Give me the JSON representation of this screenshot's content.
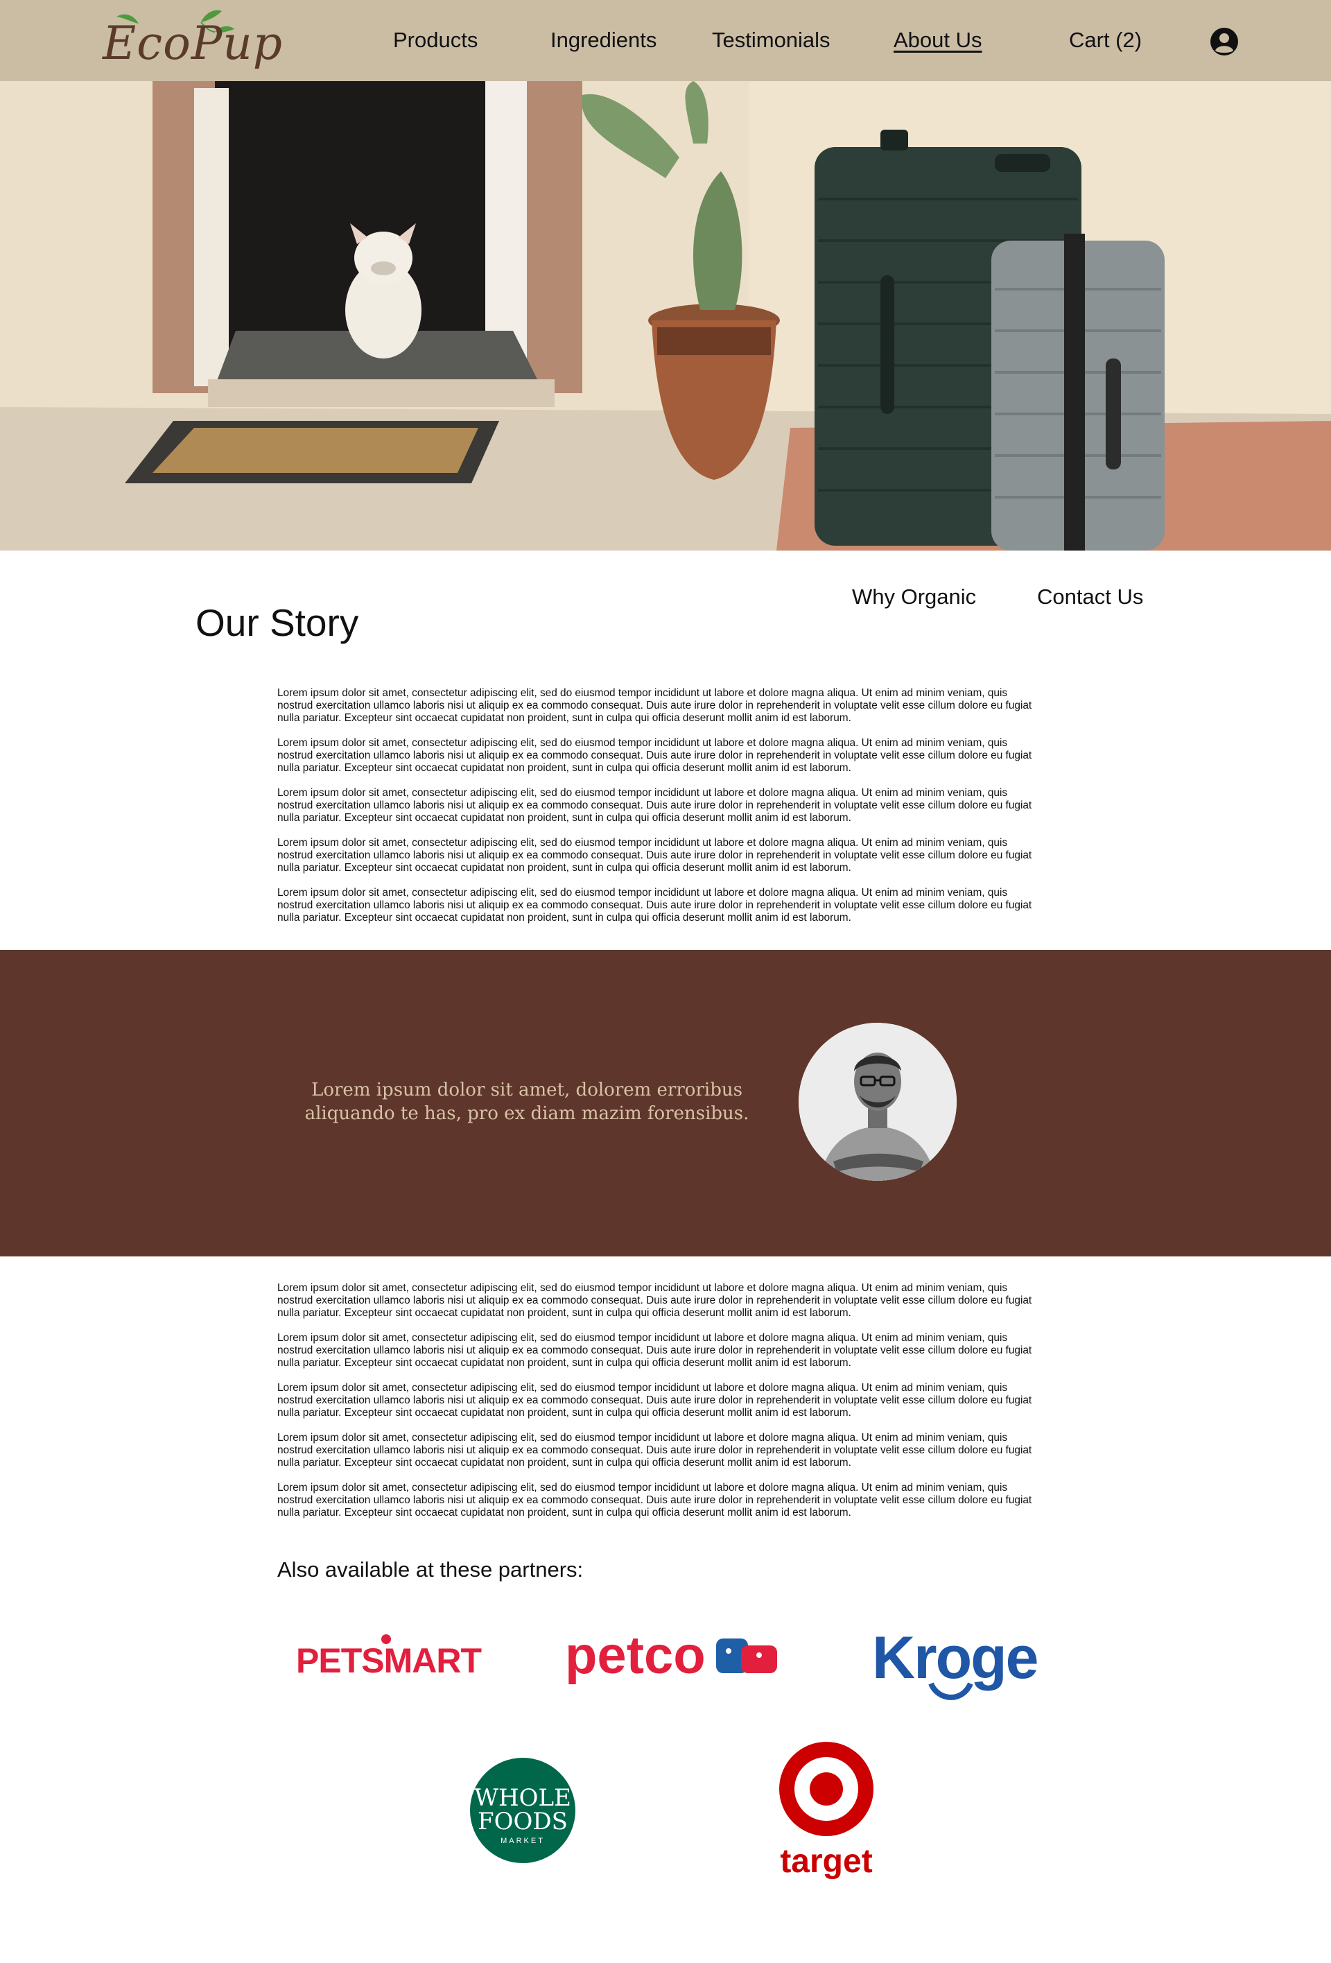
{
  "brand": {
    "name": "EcoPup",
    "color": "#5a3a2a",
    "leaf_color": "#4f9a3f"
  },
  "nav": {
    "items": [
      {
        "label": "Products",
        "active": false
      },
      {
        "label": "Ingredients",
        "active": false
      },
      {
        "label": "Testimonials",
        "active": false
      },
      {
        "label": "About Us",
        "active": true
      },
      {
        "label": "Cart (2)",
        "active": false
      }
    ],
    "account_icon": "user-circle-icon"
  },
  "colors": {
    "header_bg": "#cabda4",
    "quote_band_bg": "#5e362b",
    "quote_text": "#d8c2a8"
  },
  "story": {
    "title": "Our Story",
    "sub_nav": [
      "Why Organic",
      "Contact Us"
    ],
    "paragraphs_top": [
      "Lorem ipsum dolor sit amet, consectetur adipiscing elit, sed do eiusmod tempor incididunt ut labore et dolore magna aliqua. Ut enim ad minim veniam, quis nostrud exercitation ullamco laboris nisi ut aliquip ex ea commodo consequat. Duis aute irure dolor in reprehenderit in voluptate velit esse cillum dolore eu fugiat nulla pariatur. Excepteur sint occaecat cupidatat non proident, sunt in culpa qui officia deserunt mollit anim id est laborum.",
      "Lorem ipsum dolor sit amet, consectetur adipiscing elit, sed do eiusmod tempor incididunt ut labore et dolore magna aliqua. Ut enim ad minim veniam, quis nostrud exercitation ullamco laboris nisi ut aliquip ex ea commodo consequat. Duis aute irure dolor in reprehenderit in voluptate velit esse cillum dolore eu fugiat nulla pariatur. Excepteur sint occaecat cupidatat non proident, sunt in culpa qui officia deserunt mollit anim id est laborum.",
      "Lorem ipsum dolor sit amet, consectetur adipiscing elit, sed do eiusmod tempor incididunt ut labore et dolore magna aliqua. Ut enim ad minim veniam, quis nostrud exercitation ullamco laboris nisi ut aliquip ex ea commodo consequat. Duis aute irure dolor in reprehenderit in voluptate velit esse cillum dolore eu fugiat nulla pariatur. Excepteur sint occaecat cupidatat non proident, sunt in culpa qui officia deserunt mollit anim id est laborum.",
      "Lorem ipsum dolor sit amet, consectetur adipiscing elit, sed do eiusmod tempor incididunt ut labore et dolore magna aliqua. Ut enim ad minim veniam, quis nostrud exercitation ullamco laboris nisi ut aliquip ex ea commodo consequat. Duis aute irure dolor in reprehenderit in voluptate velit esse cillum dolore eu fugiat nulla pariatur. Excepteur sint occaecat cupidatat non proident, sunt in culpa qui officia deserunt mollit anim id est laborum.",
      "Lorem ipsum dolor sit amet, consectetur adipiscing elit, sed do eiusmod tempor incididunt ut labore et dolore magna aliqua. Ut enim ad minim veniam, quis nostrud exercitation ullamco laboris nisi ut aliquip ex ea commodo consequat. Duis aute irure dolor in reprehenderit in voluptate velit esse cillum dolore eu fugiat nulla pariatur. Excepteur sint occaecat cupidatat non proident, sunt in culpa qui officia deserunt mollit anim id est laborum."
    ],
    "paragraphs_bottom": [
      "Lorem ipsum dolor sit amet, consectetur adipiscing elit, sed do eiusmod tempor incididunt ut labore et dolore magna aliqua. Ut enim ad minim veniam, quis nostrud exercitation ullamco laboris nisi ut aliquip ex ea commodo consequat. Duis aute irure dolor in reprehenderit in voluptate velit esse cillum dolore eu fugiat nulla pariatur. Excepteur sint occaecat cupidatat non proident, sunt in culpa qui officia deserunt mollit anim id est laborum.",
      "Lorem ipsum dolor sit amet, consectetur adipiscing elit, sed do eiusmod tempor incididunt ut labore et dolore magna aliqua. Ut enim ad minim veniam, quis nostrud exercitation ullamco laboris nisi ut aliquip ex ea commodo consequat. Duis aute irure dolor in reprehenderit in voluptate velit esse cillum dolore eu fugiat nulla pariatur. Excepteur sint occaecat cupidatat non proident, sunt in culpa qui officia deserunt mollit anim id est laborum.",
      "Lorem ipsum dolor sit amet, consectetur adipiscing elit, sed do eiusmod tempor incididunt ut labore et dolore magna aliqua. Ut enim ad minim veniam, quis nostrud exercitation ullamco laboris nisi ut aliquip ex ea commodo consequat. Duis aute irure dolor in reprehenderit in voluptate velit esse cillum dolore eu fugiat nulla pariatur. Excepteur sint occaecat cupidatat non proident, sunt in culpa qui officia deserunt mollit anim id est laborum.",
      "Lorem ipsum dolor sit amet, consectetur adipiscing elit, sed do eiusmod tempor incididunt ut labore et dolore magna aliqua. Ut enim ad minim veniam, quis nostrud exercitation ullamco laboris nisi ut aliquip ex ea commodo consequat. Duis aute irure dolor in reprehenderit in voluptate velit esse cillum dolore eu fugiat nulla pariatur. Excepteur sint occaecat cupidatat non proident, sunt in culpa qui officia deserunt mollit anim id est laborum.",
      "Lorem ipsum dolor sit amet, consectetur adipiscing elit, sed do eiusmod tempor incididunt ut labore et dolore magna aliqua. Ut enim ad minim veniam, quis nostrud exercitation ullamco laboris nisi ut aliquip ex ea commodo consequat. Duis aute irure dolor in reprehenderit in voluptate velit esse cillum dolore eu fugiat nulla pariatur. Excepteur sint occaecat cupidatat non proident, sunt in culpa qui officia deserunt mollit anim id est laborum."
    ]
  },
  "quote": {
    "line1": "Lorem ipsum dolor sit amet, dolorem erroribus",
    "line2": "aliquando te has, pro ex diam mazim forensibus."
  },
  "partners": {
    "heading": "Also available at these partners:",
    "logos": [
      {
        "name": "PetSmart",
        "text": "PETSMART",
        "color": "#e21f3d"
      },
      {
        "name": "Petco",
        "text": "petco",
        "color": "#e21f3d",
        "accent": "#1f5fa8"
      },
      {
        "name": "Kroger",
        "text": "Kroger",
        "color": "#1f56a6"
      },
      {
        "name": "Whole Foods Market",
        "line1": "WHOLE",
        "line2": "FOODS",
        "line3": "MARKET",
        "color": "#00674b"
      },
      {
        "name": "Target",
        "text": "target",
        "color": "#cc0000"
      }
    ]
  }
}
